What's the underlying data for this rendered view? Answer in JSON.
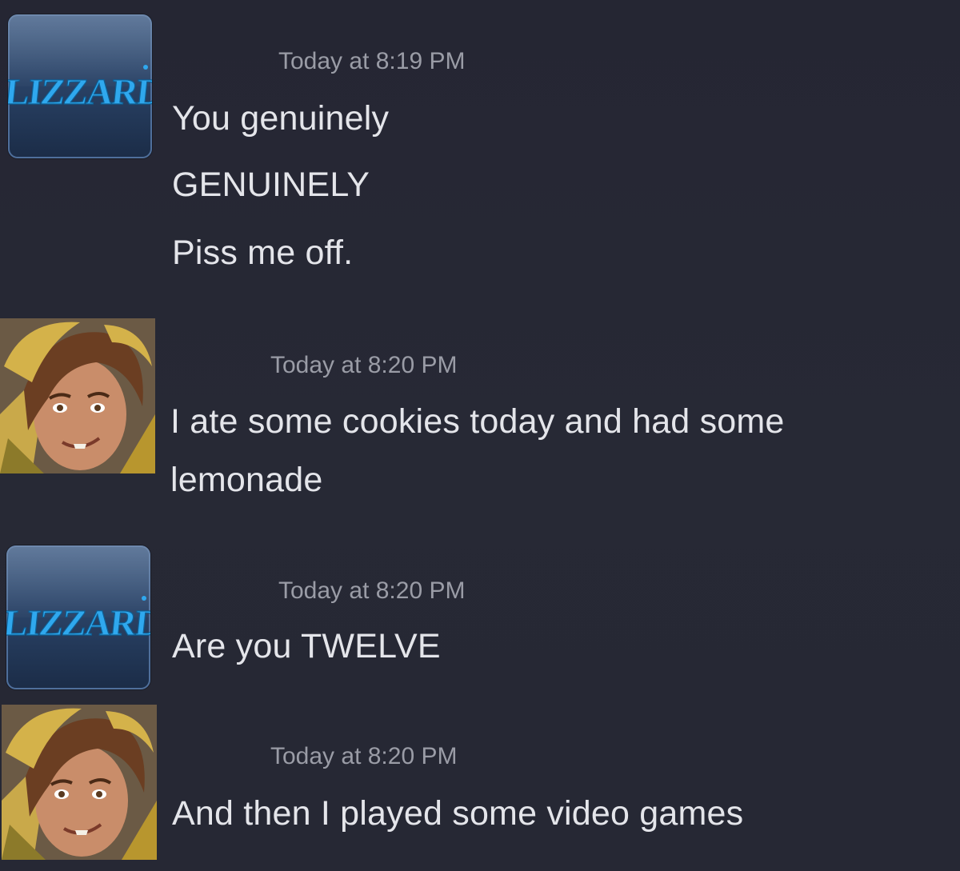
{
  "messages": [
    {
      "avatar": "blizzard-logo",
      "avatar_text": "BLIZZARD",
      "timestamp": "Today at 8:19 PM",
      "lines": [
        "You genuinely",
        "GENUINELY",
        "Piss me off."
      ]
    },
    {
      "avatar": "hero-portrait",
      "timestamp": "Today at 8:20 PM",
      "lines": [
        "I ate some cookies today and had some",
        "lemonade"
      ]
    },
    {
      "avatar": "blizzard-logo",
      "avatar_text": "BLIZZARD",
      "timestamp": "Today at 8:20 PM",
      "lines": [
        "Are you TWELVE"
      ]
    },
    {
      "avatar": "hero-portrait",
      "timestamp": "Today at 8:20 PM",
      "lines": [
        "And then I played some video games"
      ]
    }
  ],
  "colors": {
    "background": "#262835",
    "message_text": "#e4e5ea",
    "timestamp_text": "#9a9ca6",
    "blizzard_blue": "#2fa8ee"
  }
}
